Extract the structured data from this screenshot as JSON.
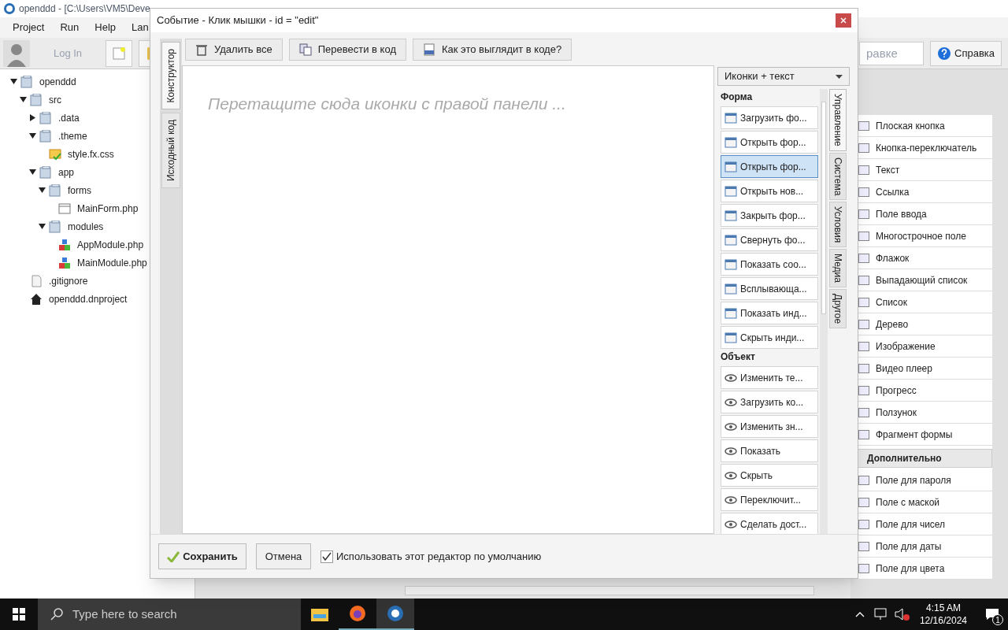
{
  "app": {
    "title": "openddd - [C:\\Users\\VM5\\Deve",
    "menu": [
      "Project",
      "Run",
      "Help",
      "Lan"
    ],
    "login": "Log In",
    "search": {
      "value": "равке"
    },
    "help_button": "Справка"
  },
  "tree": [
    {
      "label": "openddd",
      "kind": "folder",
      "expanded": true,
      "children": [
        {
          "label": "src",
          "kind": "folder",
          "expanded": true,
          "children": [
            {
              "label": ".data",
              "kind": "folder",
              "expanded": false
            },
            {
              "label": ".theme",
              "kind": "folder",
              "expanded": true,
              "children": [
                {
                  "label": "style.fx.css",
                  "kind": "css"
                }
              ]
            },
            {
              "label": "app",
              "kind": "folder",
              "expanded": true,
              "children": [
                {
                  "label": "forms",
                  "kind": "folder",
                  "expanded": true,
                  "children": [
                    {
                      "label": "MainForm.php",
                      "kind": "form"
                    }
                  ]
                },
                {
                  "label": "modules",
                  "kind": "folder",
                  "expanded": true,
                  "children": [
                    {
                      "label": "AppModule.php",
                      "kind": "module"
                    },
                    {
                      "label": "MainModule.php",
                      "kind": "module"
                    }
                  ]
                }
              ]
            }
          ]
        },
        {
          "label": ".gitignore",
          "kind": "file"
        },
        {
          "label": "openddd.dnproject",
          "kind": "project"
        }
      ]
    }
  ],
  "palette": [
    {
      "label": "Плоская кнопка",
      "kind": "item"
    },
    {
      "label": "Кнопка-переключатель",
      "kind": "item"
    },
    {
      "label": "Текст",
      "kind": "item"
    },
    {
      "label": "Ссылка",
      "kind": "item"
    },
    {
      "label": "Поле ввода",
      "kind": "item"
    },
    {
      "label": "Многострочное поле",
      "kind": "item"
    },
    {
      "label": "Флажок",
      "kind": "item"
    },
    {
      "label": "Выпадающий список",
      "kind": "item"
    },
    {
      "label": "Список",
      "kind": "item"
    },
    {
      "label": "Дерево",
      "kind": "item"
    },
    {
      "label": "Изображение",
      "kind": "item"
    },
    {
      "label": "Видео плеер",
      "kind": "item"
    },
    {
      "label": "Прогресс",
      "kind": "item"
    },
    {
      "label": "Ползунок",
      "kind": "item"
    },
    {
      "label": "Фрагмент формы",
      "kind": "item"
    },
    {
      "label": "Дополнительно",
      "kind": "header"
    },
    {
      "label": "Поле для пароля",
      "kind": "item"
    },
    {
      "label": "Поле с маской",
      "kind": "item"
    },
    {
      "label": "Поле для чисел",
      "kind": "item"
    },
    {
      "label": "Поле для даты",
      "kind": "item"
    },
    {
      "label": "Поле для цвета",
      "kind": "item"
    }
  ],
  "dialog": {
    "title": "Событие - Клик мышки - id = \"edit\"",
    "side_tabs": [
      {
        "label": "Конструктор",
        "selected": true
      },
      {
        "label": "Исходный код",
        "selected": false
      }
    ],
    "toolbar": [
      "Удалить все",
      "Перевести в код",
      "Как это выглядит в коде?"
    ],
    "canvas_placeholder": "Перетащите сюда иконки с правой панели ...",
    "view_select": "Иконки + текст",
    "sections": [
      {
        "title": "Форма",
        "items": [
          {
            "label": "Загрузить фо...",
            "selected": false
          },
          {
            "label": "Открыть фор...",
            "selected": false
          },
          {
            "label": "Открыть фор...",
            "selected": true
          },
          {
            "label": "Открыть нов...",
            "selected": false
          },
          {
            "label": "Закрыть фор...",
            "selected": false
          },
          {
            "label": "Свернуть фо...",
            "selected": false
          },
          {
            "label": "Показать соо...",
            "selected": false
          },
          {
            "label": "Всплывающа...",
            "selected": false
          },
          {
            "label": "Показать инд...",
            "selected": false
          },
          {
            "label": "Скрыть инди...",
            "selected": false
          }
        ]
      },
      {
        "title": "Объект",
        "items": [
          {
            "label": "Изменить те...",
            "selected": false
          },
          {
            "label": "Загрузить ко...",
            "selected": false
          },
          {
            "label": "Изменить зн...",
            "selected": false
          },
          {
            "label": "Показать",
            "selected": false
          },
          {
            "label": "Скрыть",
            "selected": false
          },
          {
            "label": "Переключит...",
            "selected": false
          },
          {
            "label": "Сделать дост...",
            "selected": false
          }
        ]
      }
    ],
    "category_tabs": [
      {
        "label": "Управление",
        "selected": true
      },
      {
        "label": "Система",
        "selected": false
      },
      {
        "label": "Условия",
        "selected": false
      },
      {
        "label": "Медиа",
        "selected": false
      },
      {
        "label": "Другое",
        "selected": false
      }
    ],
    "save": "Сохранить",
    "cancel": "Отмена",
    "default_editor": {
      "label": "Использовать этот редактор по умолчанию",
      "checked": true
    }
  },
  "taskbar": {
    "search_placeholder": "Type here to search",
    "time": "4:15 AM",
    "date": "12/16/2024",
    "notifications": "1"
  }
}
